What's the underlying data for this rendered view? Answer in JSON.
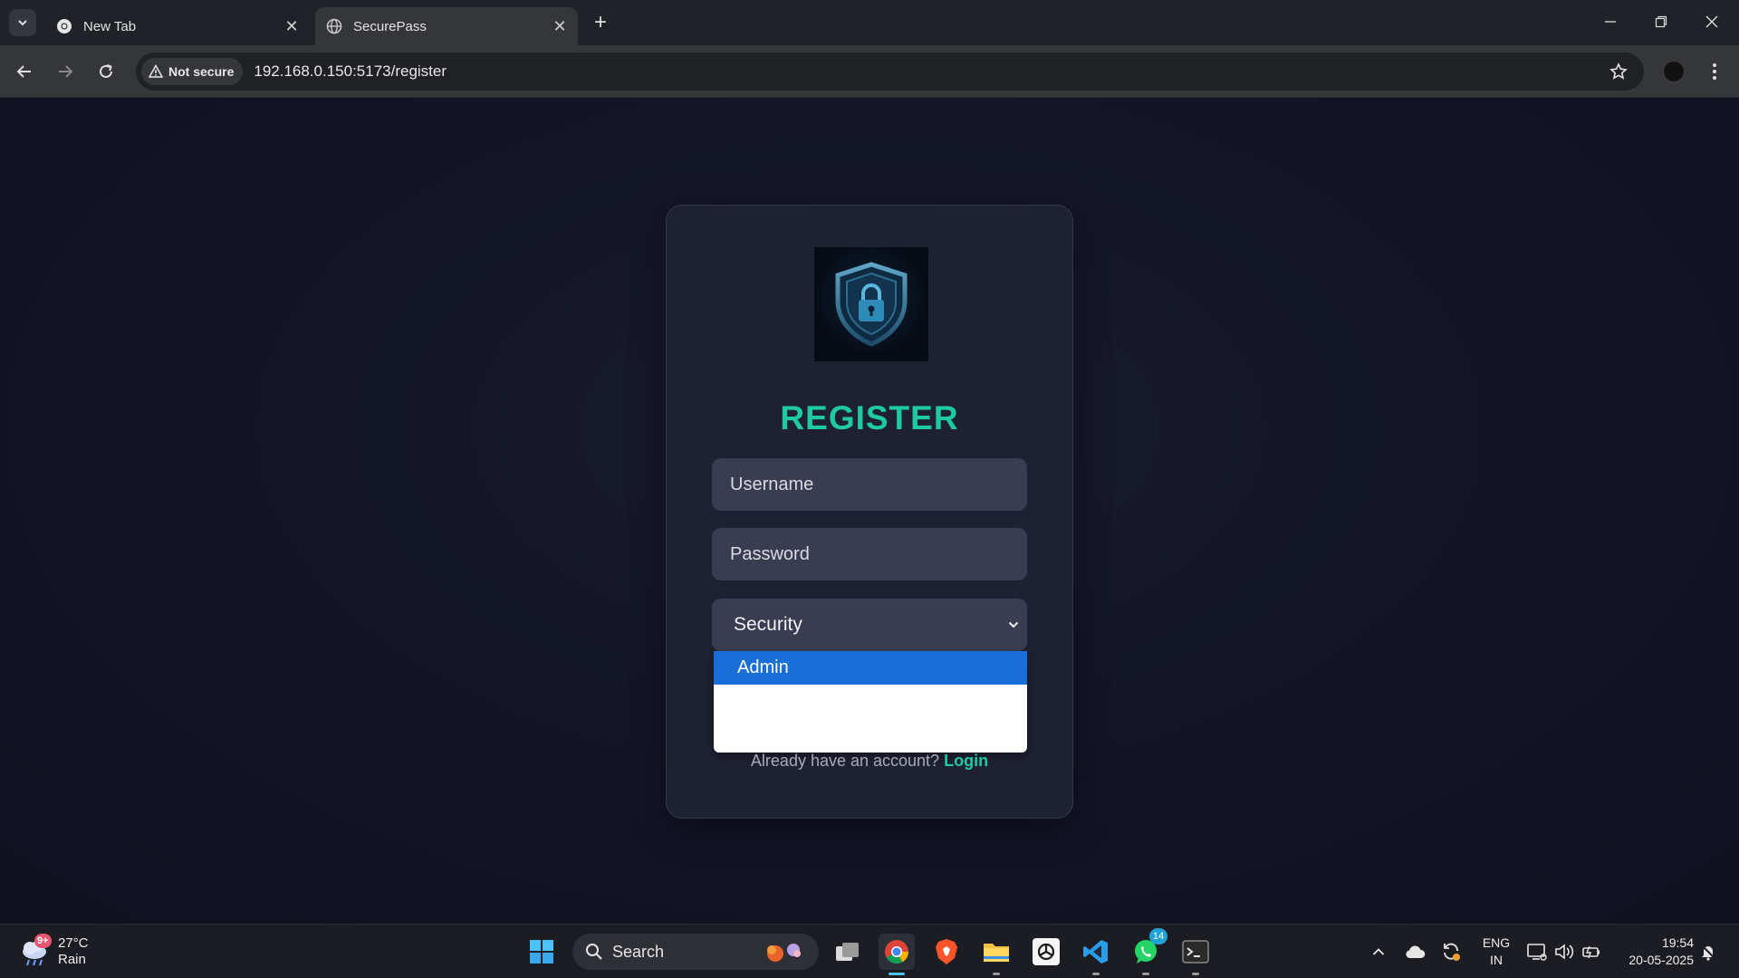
{
  "browser": {
    "tabs": [
      {
        "title": "New Tab",
        "active": false
      },
      {
        "title": "SecurePass",
        "active": true
      }
    ],
    "security_label": "Not secure",
    "url": "192.168.0.150:5173/register"
  },
  "page": {
    "title": "REGISTER",
    "username_placeholder": "Username",
    "password_placeholder": "Password",
    "role_select_value": "Security",
    "dropdown_options": [
      "Admin"
    ],
    "signin_prompt": "Already have an account?",
    "login_link": "Login",
    "accent_color": "#1fc9a3"
  },
  "taskbar": {
    "weather_temp": "27°C",
    "weather_condition": "Rain",
    "weather_badge": "9+",
    "search_label": "Search",
    "whatsapp_badge": "14",
    "lang_line1": "ENG",
    "lang_line2": "IN",
    "time": "19:54",
    "date": "20-05-2025"
  }
}
